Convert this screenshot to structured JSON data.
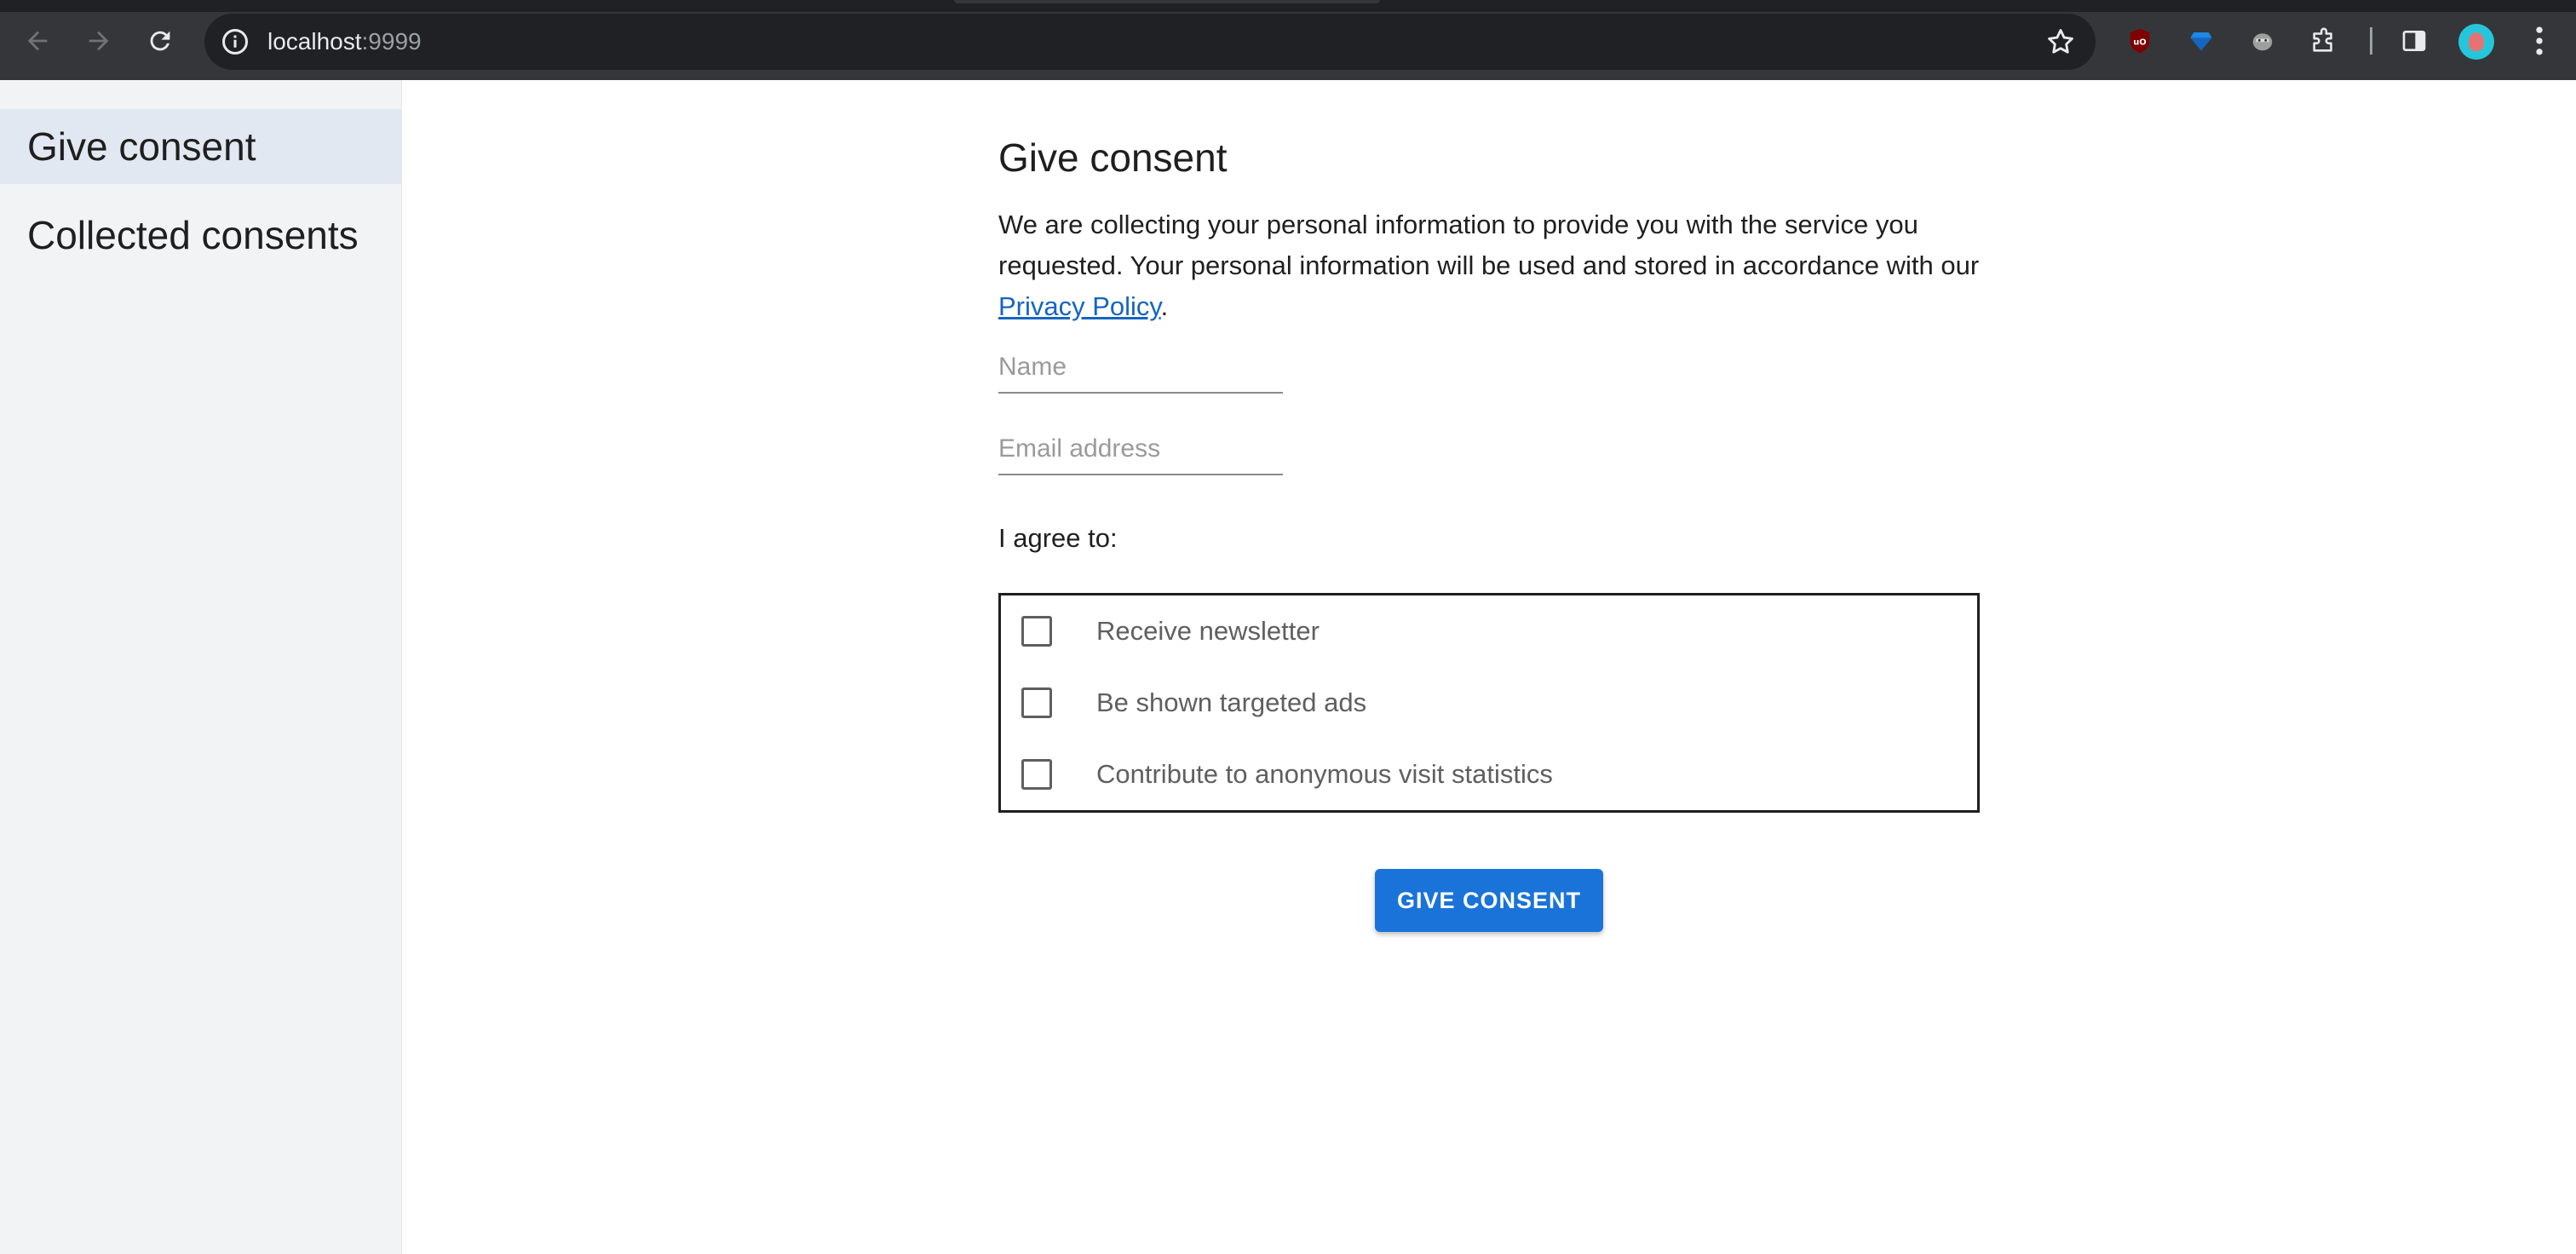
{
  "browser": {
    "url_host": "localhost",
    "url_port": ":9999"
  },
  "sidebar": {
    "items": [
      {
        "label": "Give consent"
      },
      {
        "label": "Collected consents"
      }
    ]
  },
  "form": {
    "title": "Give consent",
    "intro_before_link": "We are collecting your personal information to provide you with the service you requested. Your personal information will be used and stored in accordance with our ",
    "intro_link": "Privacy Policy",
    "intro_after_link": ".",
    "name_placeholder": "Name",
    "email_placeholder": "Email address",
    "agree_label": "I agree to:",
    "options": [
      {
        "label": "Receive newsletter",
        "checked": false
      },
      {
        "label": "Be shown targeted ads",
        "checked": false
      },
      {
        "label": "Contribute to anonymous visit statistics",
        "checked": false
      }
    ],
    "submit_label": "GIVE CONSENT"
  },
  "colors": {
    "primary": "#1a73d9",
    "link": "#1565c0",
    "sidebar_bg": "#f2f3f5",
    "sidebar_active_bg": "#e2e8f1"
  }
}
